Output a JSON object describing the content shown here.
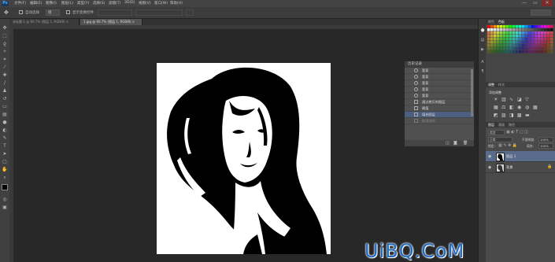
{
  "app": {
    "logo": "Ps"
  },
  "menu": [
    "文件(F)",
    "编辑(E)",
    "图像(I)",
    "图层(L)",
    "类型(Y)",
    "选择(S)",
    "滤镜(T)",
    "3D(D)",
    "视图(V)",
    "窗口(W)",
    "帮助(H)"
  ],
  "window_controls": {
    "minimize": "—",
    "restore": "▭",
    "close": "✕"
  },
  "options_bar": {
    "auto_select_label": "自动选择",
    "auto_select_value": "组",
    "transform_label": "显示变换控件"
  },
  "tabs": [
    {
      "label": "未标题-1 @ 66.7% (图层 1, RGB/8) ×",
      "active": false
    },
    {
      "label": "1.jpg @ 66.7% (图层 1, RGB/8) ×",
      "active": true
    }
  ],
  "history": {
    "title": "历史记录",
    "items": [
      {
        "label": "套索",
        "selected": false,
        "dim": false
      },
      {
        "label": "套索",
        "selected": false,
        "dim": false
      },
      {
        "label": "套索",
        "selected": false,
        "dim": false
      },
      {
        "label": "套索",
        "selected": false,
        "dim": false
      },
      {
        "label": "套索",
        "selected": false,
        "dim": false
      },
      {
        "label": "通过拷贝的图层",
        "selected": false,
        "dim": false
      },
      {
        "label": "阈值",
        "selected": false,
        "dim": false
      },
      {
        "label": "填充图层",
        "selected": true,
        "dim": false
      },
      {
        "label": "取消选择",
        "selected": false,
        "dim": true
      }
    ]
  },
  "right_panel": {
    "swatch_tabs": [
      "颜色",
      "色板"
    ],
    "adjust_tabs": [
      "调整",
      "样式"
    ],
    "adjust_title": "添加调整",
    "layers_tabs": [
      "图层",
      "通道",
      "路径"
    ],
    "kind_label": "类型",
    "blend_mode": "正常",
    "opacity_label": "不透明度:",
    "opacity_value": "100%",
    "lock_label": "锁定:",
    "fill_label": "填充:",
    "fill_value": "100%",
    "layers": [
      {
        "name": "图层 1",
        "selected": true
      },
      {
        "name": "背景",
        "selected": false
      }
    ]
  },
  "watermark": "UiBQ.CoM",
  "colors": {
    "accent": "#1f6cc6",
    "selection": "#5a6c8c"
  }
}
